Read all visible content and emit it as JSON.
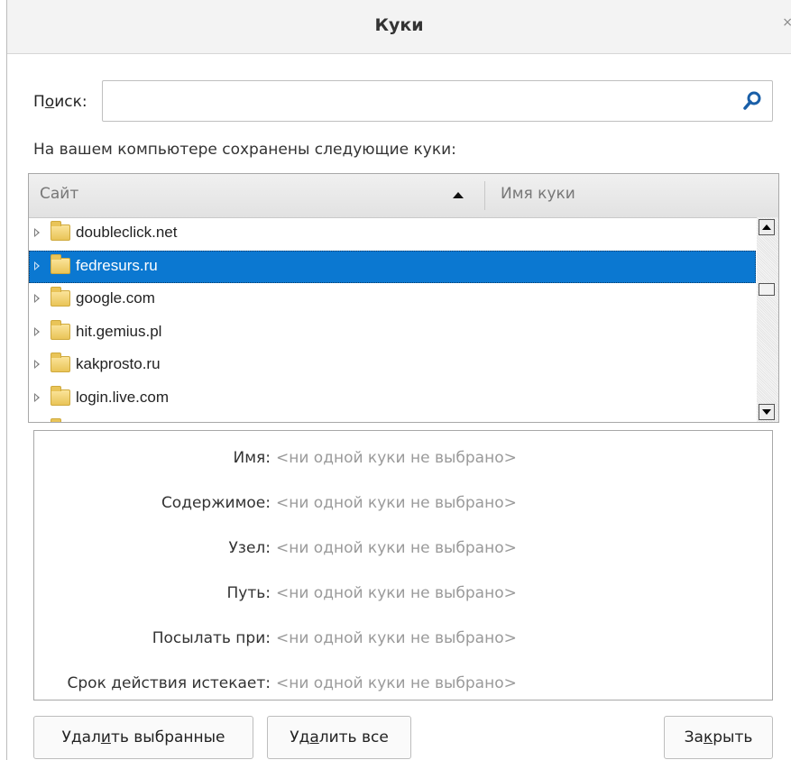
{
  "window": {
    "title": "Куки",
    "close_glyph": "×"
  },
  "search": {
    "label_prefix": "П",
    "label_access": "о",
    "label_suffix": "иск:",
    "value": "",
    "placeholder": "",
    "icon": "search-icon"
  },
  "description": "На вашем компьютере сохранены следующие куки:",
  "tree": {
    "columns": {
      "site": "Сайт",
      "cookie_name": "Имя куки"
    },
    "sort": "ascending",
    "rows": [
      {
        "label": "doubleclick.net",
        "selected": false
      },
      {
        "label": "fedresurs.ru",
        "selected": true
      },
      {
        "label": "google.com",
        "selected": false
      },
      {
        "label": "hit.gemius.pl",
        "selected": false
      },
      {
        "label": "kakprosto.ru",
        "selected": false
      },
      {
        "label": "login.live.com",
        "selected": false
      }
    ]
  },
  "details": {
    "fields": [
      {
        "label": "Имя:",
        "value": "<ни одной куки не выбрано>"
      },
      {
        "label": "Содержимое:",
        "value": "<ни одной куки не выбрано>"
      },
      {
        "label": "Узел:",
        "value": "<ни одной куки не выбрано>"
      },
      {
        "label": "Путь:",
        "value": "<ни одной куки не выбрано>"
      },
      {
        "label": "Посылать при:",
        "value": "<ни одной куки не выбрано>"
      },
      {
        "label": "Срок действия истекает:",
        "value": "<ни одной куки не выбрано>"
      }
    ]
  },
  "buttons": {
    "delete_selected": {
      "pre": "Удал",
      "access": "и",
      "post": "ть выбранные"
    },
    "delete_all": {
      "pre": "Уд",
      "access": "а",
      "post": "лить все"
    },
    "close": {
      "pre": "За",
      "access": "к",
      "post": "рыть"
    }
  },
  "colors": {
    "selection": "#0b78d1",
    "placeholder_text": "#9a9a9a",
    "folder": "#e9c458"
  }
}
